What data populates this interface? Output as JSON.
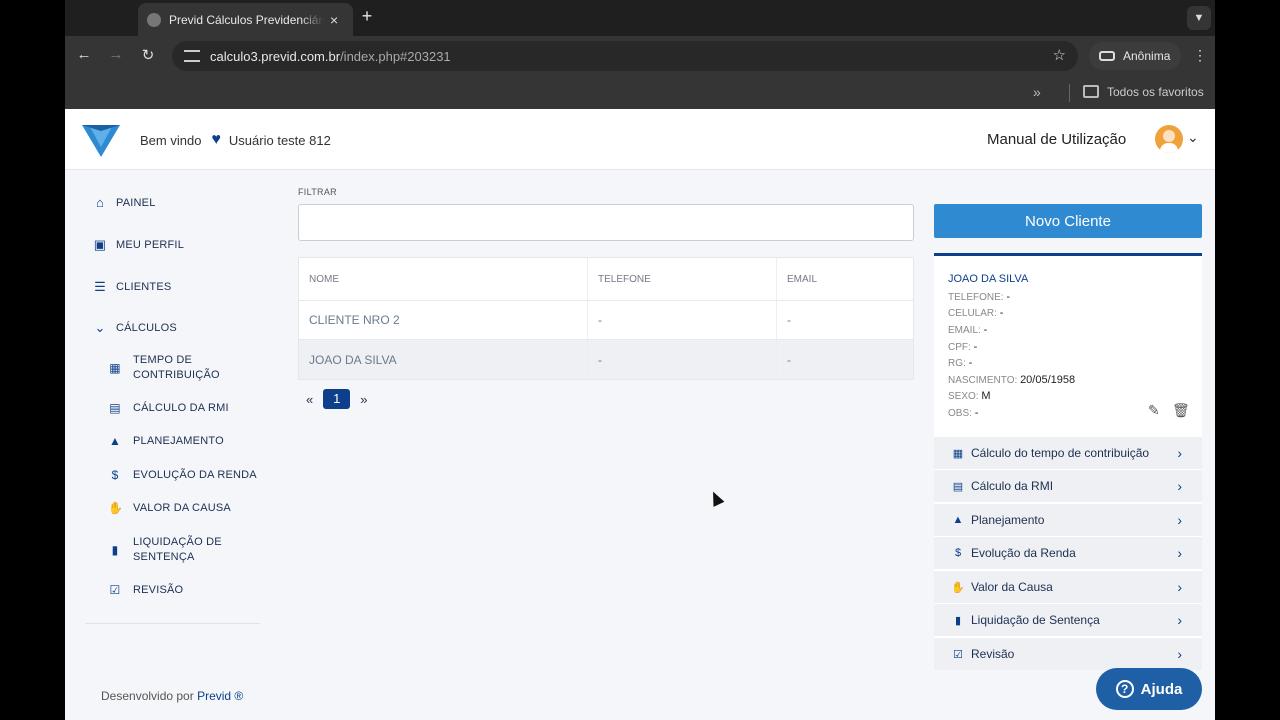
{
  "browser": {
    "tab_title": "Previd Cálculos Previdenciários",
    "tab_close": "×",
    "new_tab": "+",
    "url_host": "calculo3.previd.com.br",
    "url_path": "/index.php#203231",
    "profile_label": "Anônima",
    "bookmarks_label": "Todos os favoritos"
  },
  "header": {
    "welcome": "Bem vindo",
    "user": "Usuário teste 812",
    "manual_label": "Manual de Utilização"
  },
  "sidebar": {
    "items": [
      {
        "label": "PAINEL",
        "icon": "home-icon"
      },
      {
        "label": "MEU PERFIL",
        "icon": "id-card-icon"
      },
      {
        "label": "CLIENTES",
        "icon": "list-icon"
      },
      {
        "label": "CÁLCULOS",
        "icon": "chevron-down-icon"
      }
    ],
    "sub_items": [
      {
        "label_1": "TEMPO DE",
        "label_2": "CONTRIBUIÇÃO",
        "icon": "calendar-icon"
      },
      {
        "label": "CÁLCULO DA RMI",
        "icon": "calculator-icon"
      },
      {
        "label": "PLANEJAMENTO",
        "icon": "road-icon"
      },
      {
        "label": "EVOLUÇÃO DA RENDA",
        "icon": "dollar-icon"
      },
      {
        "label": "VALOR DA CAUSA",
        "icon": "hand-coin-icon"
      },
      {
        "label_1": "LIQUIDAÇÃO DE",
        "label_2": "SENTENÇA",
        "icon": "invoice-icon"
      },
      {
        "label": "REVISÃO",
        "icon": "clipboard-check-icon"
      }
    ],
    "footer_prefix": "Desenvolvido por",
    "footer_brand": "Previd ®"
  },
  "main": {
    "filter_label": "FILTRAR",
    "filter_value": "",
    "columns": [
      "NOME",
      "TELEFONE",
      "EMAIL"
    ],
    "rows": [
      [
        "CLIENTE NRO 2",
        "-",
        "-"
      ],
      [
        "JOAO DA SILVA",
        "-",
        "-"
      ]
    ],
    "pager": {
      "prev": "«",
      "current": "1",
      "next": "»"
    }
  },
  "client": {
    "new_button": "Novo Cliente",
    "name": "JOAO DA SILVA",
    "fields": [
      {
        "label": "TELEFONE:",
        "value": "-"
      },
      {
        "label": "CELULAR:",
        "value": "-"
      },
      {
        "label": "EMAIL:",
        "value": "-"
      },
      {
        "label": "CPF:",
        "value": "-"
      },
      {
        "label": "RG:",
        "value": "-"
      },
      {
        "label": "NASCIMENTO:",
        "value": "20/05/1958"
      },
      {
        "label": "SEXO:",
        "value": "M"
      },
      {
        "label": "OBS:",
        "value": "-"
      }
    ],
    "actions": [
      {
        "label": "Cálculo do tempo de contribuição",
        "icon": "calendar-icon"
      },
      {
        "label": "Cálculo da RMI",
        "icon": "calculator-icon"
      },
      {
        "label": "Planejamento",
        "icon": "road-icon"
      },
      {
        "label": "Evolução da Renda",
        "icon": "dollar-icon"
      },
      {
        "label": "Valor da Causa",
        "icon": "hand-coin-icon"
      },
      {
        "label": "Liquidação de Sentença",
        "icon": "invoice-icon"
      },
      {
        "label": "Revisão",
        "icon": "clipboard-check-icon"
      }
    ]
  },
  "help": {
    "label": "Ajuda"
  },
  "colors": {
    "primary": "#0d3f8a",
    "button": "#2f8ad1",
    "help": "#1f5fa5"
  }
}
